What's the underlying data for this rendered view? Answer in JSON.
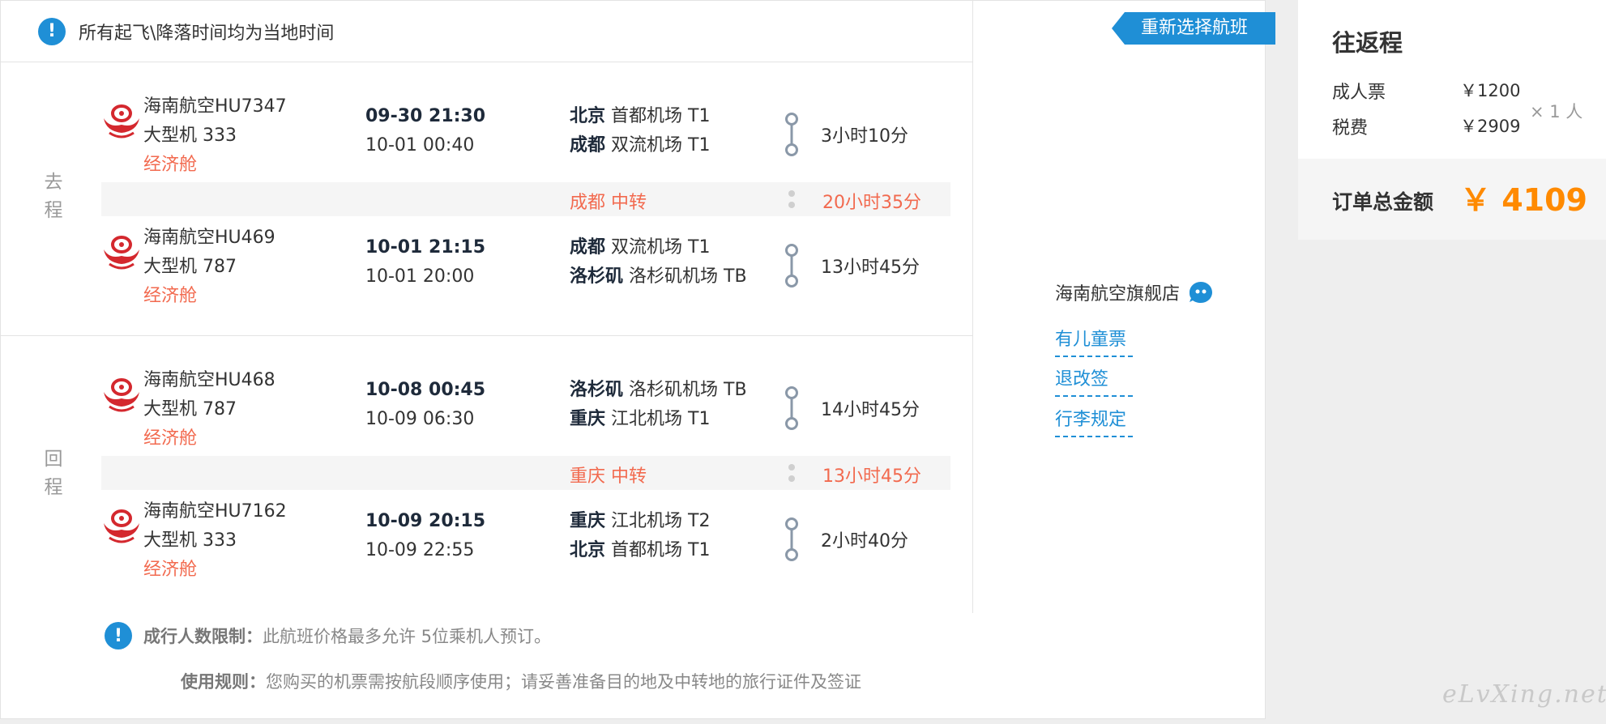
{
  "notice": {
    "text": "所有起飞\\降落时间均为当地时间"
  },
  "outbound": {
    "label": [
      "去",
      "程"
    ],
    "flights": [
      {
        "airline": "海南航空HU7347",
        "aircraft": "大型机 333",
        "cabin": "经济舱",
        "dep_time": "09-30 21:30",
        "arr_time": "10-01 00:40",
        "dep_city": "北京",
        "dep_airport": "首都机场 T1",
        "arr_city": "成都",
        "arr_airport": "双流机场 T1",
        "duration": "3小时10分"
      },
      {
        "airline": "海南航空HU469",
        "aircraft": "大型机 787",
        "cabin": "经济舱",
        "dep_time": "10-01 21:15",
        "arr_time": "10-01 20:00",
        "dep_city": "成都",
        "dep_airport": "双流机场 T1",
        "arr_city": "洛杉矶",
        "arr_airport": "洛杉矶机场 TB",
        "duration": "13小时45分"
      }
    ],
    "transfer": {
      "city": "成都 中转",
      "duration": "20小时35分"
    }
  },
  "return": {
    "label": [
      "回",
      "程"
    ],
    "flights": [
      {
        "airline": "海南航空HU468",
        "aircraft": "大型机 787",
        "cabin": "经济舱",
        "dep_time": "10-08 00:45",
        "arr_time": "10-09 06:30",
        "dep_city": "洛杉矶",
        "dep_airport": "洛杉矶机场 TB",
        "arr_city": "重庆",
        "arr_airport": "江北机场 T1",
        "duration": "14小时45分"
      },
      {
        "airline": "海南航空HU7162",
        "aircraft": "大型机 333",
        "cabin": "经济舱",
        "dep_time": "10-09 20:15",
        "arr_time": "10-09 22:55",
        "dep_city": "重庆",
        "dep_airport": "江北机场 T2",
        "arr_city": "北京",
        "arr_airport": "首都机场 T1",
        "duration": "2小时40分"
      }
    ],
    "transfer": {
      "city": "重庆 中转",
      "duration": "13小时45分"
    }
  },
  "side": {
    "reselect": "重新选择航班",
    "shop": "海南航空旗舰店",
    "links": [
      "有儿童票",
      "退改签",
      "行李规定"
    ]
  },
  "bottom": {
    "limit_label": "成行人数限制：",
    "limit_text": "此航班价格最多允许 5位乘机人预订。",
    "rule_label": "使用规则：",
    "rule_text": "您购买的机票需按航段顺序使用；请妥善准备目的地及中转地的旅行证件及签证"
  },
  "price": {
    "title": "往返程",
    "adult_label": "成人票",
    "adult_value": "￥1200",
    "tax_label": "税费",
    "tax_value": "￥2909",
    "multiplier": "× 1 人",
    "total_label": "订单总金额",
    "total_value": "￥ 4109"
  },
  "watermark": "eLvXing.net",
  "colors": {
    "accent": "#1f8fd6",
    "warning": "#f26a4f",
    "total": "#ff8a00"
  }
}
